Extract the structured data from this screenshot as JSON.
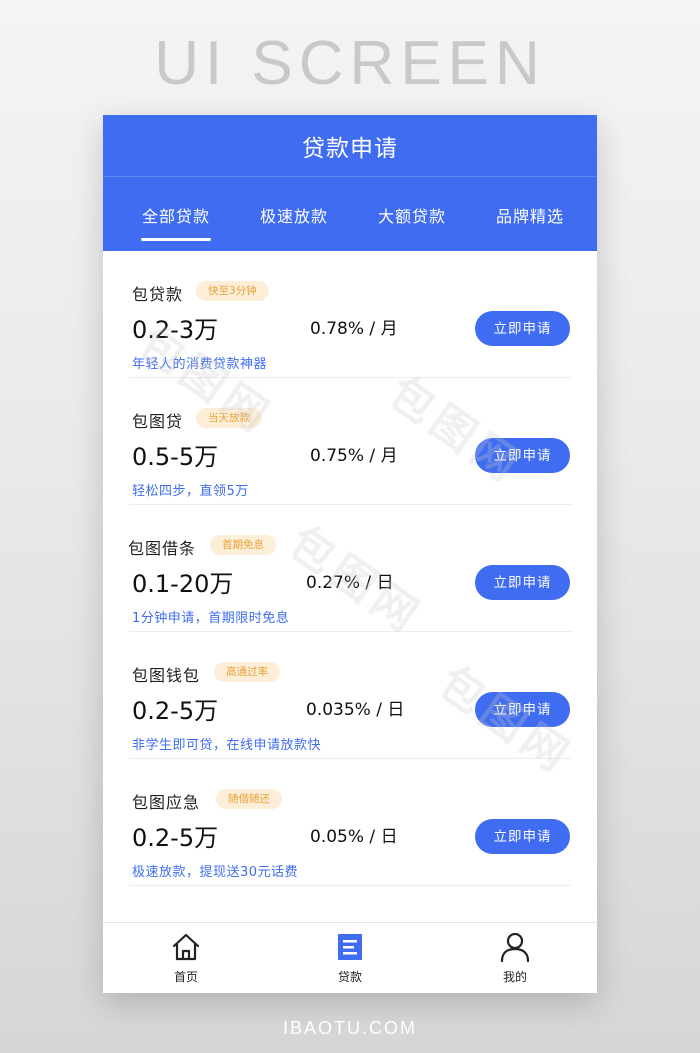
{
  "poster": {
    "heading": "UI SCREEN",
    "footer_site": "IBAOTU.COM"
  },
  "app": {
    "title": "贷款申请",
    "tabs": [
      {
        "label": "全部贷款",
        "active": true
      },
      {
        "label": "极速放款",
        "active": false
      },
      {
        "label": "大额贷款",
        "active": false
      },
      {
        "label": "品牌精选",
        "active": false
      }
    ],
    "loans": [
      {
        "name": "包贷款",
        "tag": "快至3分钟",
        "amount": "0.2-3万",
        "rate": "0.78%",
        "unit": "月",
        "desc": "年轻人的消费贷款神器",
        "button": "立即申请"
      },
      {
        "name": "包图贷",
        "tag": "当天放款",
        "amount": "0.5-5万",
        "rate": "0.75%",
        "unit": "月",
        "desc": "轻松四步，直领5万",
        "button": "立即申请"
      },
      {
        "name": "包图借条",
        "tag": "首期免息",
        "amount": "0.1-20万",
        "rate": "0.27%",
        "unit": "日",
        "desc": "1分钟申请，首期限时免息",
        "button": "立即申请"
      },
      {
        "name": "包图钱包",
        "tag": "高通过率",
        "amount": "0.2-5万",
        "rate": "0.035%",
        "unit": "日",
        "desc": "非学生即可贷，在线申请放款快",
        "button": "立即申请"
      },
      {
        "name": "包图应急",
        "tag": "随借随还",
        "amount": "0.2-5万",
        "rate": "0.05%",
        "unit": "日",
        "desc": "极速放款，提现送30元话费",
        "button": "立即申请"
      }
    ],
    "nav": [
      {
        "label": "首页",
        "icon": "home-icon"
      },
      {
        "label": "贷款",
        "icon": "list-icon"
      },
      {
        "label": "我的",
        "icon": "user-icon"
      }
    ]
  },
  "watermark": "包图网",
  "colors": {
    "brand": "#3f6cf0",
    "tag_bg": "#fdeed8",
    "tag_text": "#e9a13a"
  }
}
